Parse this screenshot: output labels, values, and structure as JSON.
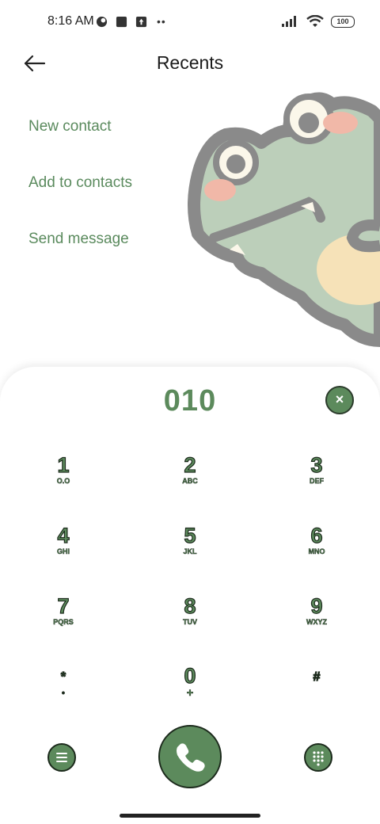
{
  "status_bar": {
    "time": "8:16 AM",
    "battery": "100",
    "left_icons": [
      "app-logo-icon",
      "square-app-icon",
      "upload-icon",
      "more-dots-icon"
    ],
    "right_icons": [
      "signal-icon",
      "wifi-icon",
      "battery-icon"
    ]
  },
  "header": {
    "title": "Recents",
    "back_icon": "arrow-left-icon"
  },
  "options": [
    {
      "label": "New contact"
    },
    {
      "label": "Add to contacts"
    },
    {
      "label": "Send message"
    }
  ],
  "dialpad": {
    "number": "010",
    "clear_label": "×",
    "keys": [
      {
        "digit": "1",
        "letters": "O.O"
      },
      {
        "digit": "2",
        "letters": "ABC"
      },
      {
        "digit": "3",
        "letters": "DEF"
      },
      {
        "digit": "4",
        "letters": "GHI"
      },
      {
        "digit": "5",
        "letters": "JKL"
      },
      {
        "digit": "6",
        "letters": "MNO"
      },
      {
        "digit": "7",
        "letters": "PQRS"
      },
      {
        "digit": "8",
        "letters": "TUV"
      },
      {
        "digit": "9",
        "letters": "WXYZ"
      },
      {
        "digit": "*",
        "letters": "•"
      },
      {
        "digit": "0",
        "letters": "+"
      },
      {
        "digit": "#",
        "letters": ""
      }
    ],
    "bottom_icons": [
      "menu-icon",
      "phone-icon",
      "keypad-grid-icon"
    ]
  },
  "colors": {
    "accent": "#5c8a5c",
    "option_text": "#5a8a5d",
    "outline": "#1c2a1c",
    "frog_body": "#bccfba",
    "frog_outline": "#8a8a8a",
    "frog_cheek": "#f1b8a8",
    "frog_belly": "#f6e2b8"
  }
}
